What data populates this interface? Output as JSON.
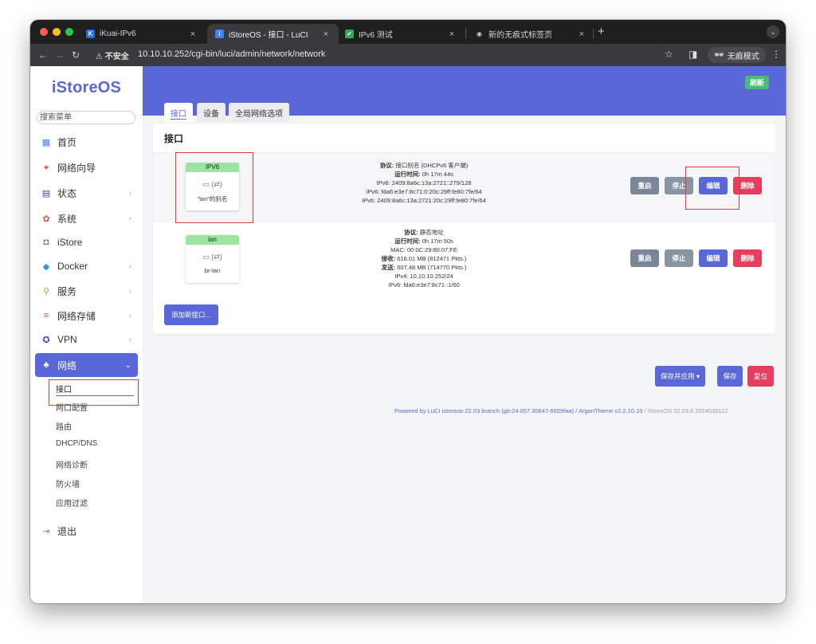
{
  "browser": {
    "tabs": [
      {
        "title": "iKuai-IPv6",
        "favicon": "K",
        "close": "×"
      },
      {
        "title": "iStoreOS - 接口 - LuCI",
        "favicon": "i",
        "close": "×"
      },
      {
        "title": "IPv6 测试",
        "favicon": "✔",
        "close": "×"
      },
      {
        "title": "新的无痕式标签页",
        "favicon": "◉",
        "close": "×"
      }
    ],
    "new_tab": "+",
    "insecure_label": "⚠ 不安全",
    "url": "10.10.10.252/cgi-bin/luci/admin/network/network",
    "incognito_label": "无痕模式"
  },
  "sidebar": {
    "brand": "iStoreOS",
    "search_placeholder": "搜索菜单",
    "items": [
      {
        "label": "首页",
        "icon": "dashboard-icon",
        "chevron": false
      },
      {
        "label": "网络向导",
        "icon": "wizard-icon",
        "chevron": false
      },
      {
        "label": "状态",
        "icon": "status-grid-icon",
        "chevron": true
      },
      {
        "label": "系统",
        "icon": "system-gear-icon",
        "chevron": true
      },
      {
        "label": "iStore",
        "icon": "store-bag-icon",
        "chevron": false
      },
      {
        "label": "Docker",
        "icon": "docker-whale-icon",
        "chevron": true
      },
      {
        "label": "服务",
        "icon": "services-icon",
        "chevron": true
      },
      {
        "label": "网络存储",
        "icon": "storage-icon",
        "chevron": true
      },
      {
        "label": "VPN",
        "icon": "vpn-icon",
        "chevron": true
      },
      {
        "label": "网络",
        "icon": "network-tree-icon",
        "chevron": true,
        "active": true
      }
    ],
    "sub_items": [
      "接口",
      "网口配置",
      "路由",
      "DHCP/DNS",
      "网络诊断",
      "防火墙",
      "应用过滤"
    ],
    "logout": "退出"
  },
  "main": {
    "refresh_label": "刷新",
    "tabs": [
      "接口",
      "设备",
      "全局网络选项"
    ],
    "section_title": "接口",
    "interfaces": [
      {
        "name": "IPV6",
        "icon_text": "(⇄)",
        "device": "\"lan\"的别名",
        "details": [
          {
            "label": "协议:",
            "value": " 接口别名 (DHCPv6 客户端)"
          },
          {
            "label": "运行时间:",
            "value": " 0h 17m 44s"
          },
          {
            "label": "",
            "value": "IPv6: 2409:8a6c:13a:2721::279/128"
          },
          {
            "label": "",
            "value": "IPv6: fda6:e3e7:8c71:0:20c:29ff:fe80:7fe/64"
          },
          {
            "label": "",
            "value": "IPv6: 2409:8a6c:13a:2721:20c:29ff:fe80:7fe/64"
          }
        ]
      },
      {
        "name": "lan",
        "icon_text": "(⇄)",
        "device": "br-lan",
        "details": [
          {
            "label": "协议:",
            "value": " 静态地址"
          },
          {
            "label": "运行时间:",
            "value": " 0h 17m 50s"
          },
          {
            "label": "",
            "value": "MAC: 00:0C:29:80:07:FE"
          },
          {
            "label": "接收:",
            "value": " 616.01 MB (812471 Pkts.)"
          },
          {
            "label": "发送:",
            "value": " 607.48 MB (714770 Pkts.)"
          },
          {
            "label": "",
            "value": "IPv4: 10.10.10.252/24"
          },
          {
            "label": "",
            "value": "IPv6: fda6:e3e7:8c71::1/60"
          }
        ]
      }
    ],
    "actions": {
      "restart": "重启",
      "stop": "停止",
      "edit": "编辑",
      "delete": "删除"
    },
    "add_interface": "添加新接口...",
    "save_apply": "保存并应用 ▾",
    "save": "保存",
    "reset": "复位",
    "footer_link": "Powered by LuCI istoreos-22.03 branch (git-24.057.30647-6659faa) / ArgonTheme v2.2.10.10",
    "footer_version": " / iStoreOS 22.03.6 2024030112"
  },
  "colors": {
    "accent": "#5a67d8",
    "success": "#48bb78",
    "danger": "#e53e5f",
    "annotation": "#e23b3b"
  }
}
